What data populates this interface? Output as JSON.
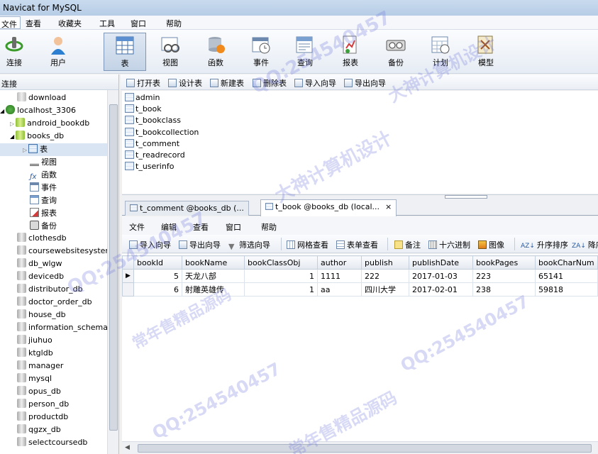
{
  "window": {
    "title": "Navicat for MySQL"
  },
  "menu": [
    "文件",
    "查看",
    "收藏夹",
    "工具",
    "窗口",
    "帮助"
  ],
  "toolbar": {
    "buttons": [
      {
        "label": "连接",
        "icon": "connection-icon"
      },
      {
        "label": "用户",
        "icon": "user-icon"
      },
      {
        "label": "表",
        "icon": "table-icon"
      },
      {
        "label": "视图",
        "icon": "view-icon"
      },
      {
        "label": "函数",
        "icon": "function-icon"
      },
      {
        "label": "事件",
        "icon": "event-icon"
      },
      {
        "label": "查询",
        "icon": "query-icon"
      },
      {
        "label": "报表",
        "icon": "report-icon"
      },
      {
        "label": "备份",
        "icon": "backup-icon"
      },
      {
        "label": "计划",
        "icon": "schedule-icon"
      },
      {
        "label": "模型",
        "icon": "model-icon"
      }
    ],
    "active": "表"
  },
  "sidebar": {
    "header": "连接",
    "tree": {
      "top": "download",
      "connection": "localhost_3306",
      "db_before": "android_bookdb",
      "current_db": "books_db",
      "objects": [
        "表",
        "视图",
        "函数",
        "事件",
        "查询",
        "报表",
        "备份"
      ],
      "databases": [
        "clothesdb",
        "coursewebsitesyster",
        "db_wlgw",
        "devicedb",
        "distributor_db",
        "doctor_order_db",
        "house_db",
        "information_schema",
        "jiuhuo",
        "ktgldb",
        "manager",
        "mysql",
        "opus_db",
        "person_db",
        "productdb",
        "qgzx_db",
        "selectcoursedb"
      ]
    }
  },
  "object_toolbar": [
    "打开表",
    "设计表",
    "新建表",
    "删除表",
    "导入向导",
    "导出向导"
  ],
  "tables": [
    "admin",
    "t_book",
    "t_bookclass",
    "t_bookcollection",
    "t_comment",
    "t_readrecord",
    "t_userinfo"
  ],
  "tabs": [
    {
      "label": "t_comment @books_db (...",
      "close": "×"
    },
    {
      "label": "t_book @books_db (local...",
      "close": "×"
    }
  ],
  "inner_menu": [
    "文件",
    "编辑",
    "查看",
    "窗口",
    "帮助"
  ],
  "inner_toolbar": [
    "导入向导",
    "导出向导",
    "筛选向导",
    "网格查看",
    "表单查看",
    "备注",
    "十六进制",
    "图像",
    "升序排序",
    "降序"
  ],
  "grid": {
    "columns": [
      "bookId",
      "bookName",
      "bookClassObj",
      "author",
      "publish",
      "publishDate",
      "bookPages",
      "bookCharNum"
    ],
    "rows": [
      [
        "5",
        "天龙八部",
        "1",
        "1111",
        "222",
        "2017-01-03",
        "223",
        "65141"
      ],
      [
        "6",
        "射雕英雄传",
        "1",
        "aa",
        "四川大学",
        "2017-02-01",
        "238",
        "59818"
      ]
    ],
    "current_row_marker": "▶"
  },
  "watermarks": [
    "QQ:254540457",
    "常年售精品源码",
    "大神计算机设计"
  ],
  "colors": {
    "accent": "#4a6fa5",
    "titlebar": "#b6cce6",
    "selection": "#d9e5f3"
  }
}
